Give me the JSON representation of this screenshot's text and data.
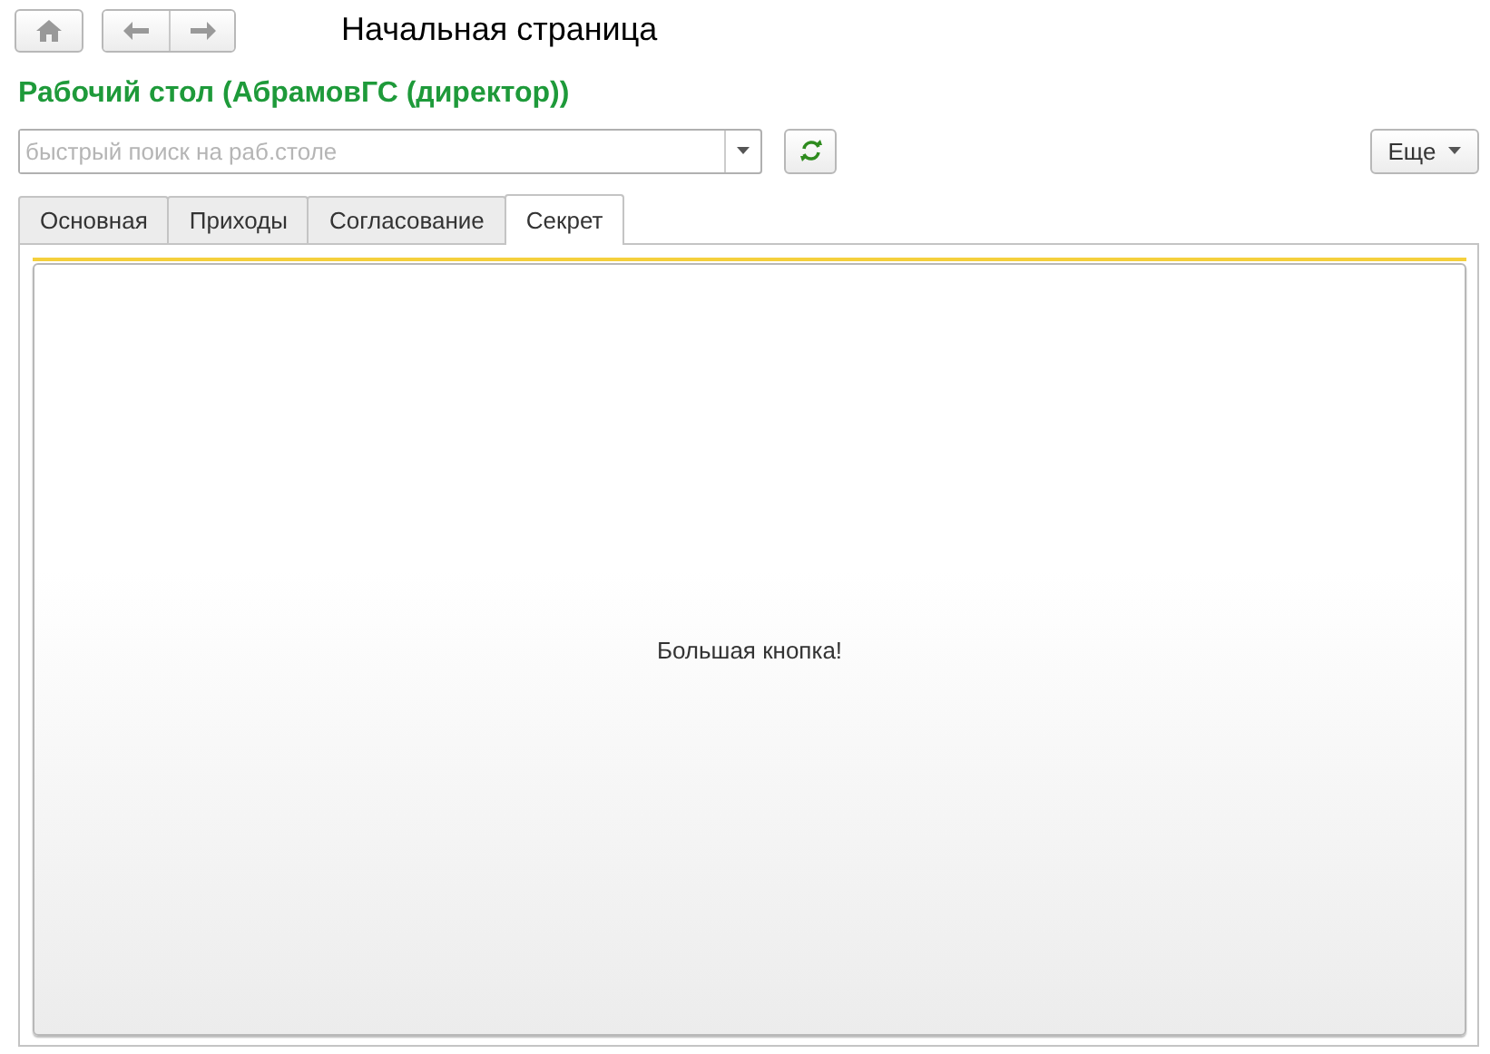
{
  "window": {
    "title": "Начальная страница"
  },
  "heading": "Рабочий стол (АбрамовГС (директор))",
  "search": {
    "placeholder": "быстрый поиск на раб.столе"
  },
  "more_button": "Еще",
  "tabs": [
    {
      "label": "Основная",
      "selected": false
    },
    {
      "label": "Приходы",
      "selected": false
    },
    {
      "label": "Согласование",
      "selected": false
    },
    {
      "label": "Секрет",
      "selected": true
    }
  ],
  "big_button": "Большая кнопка!"
}
